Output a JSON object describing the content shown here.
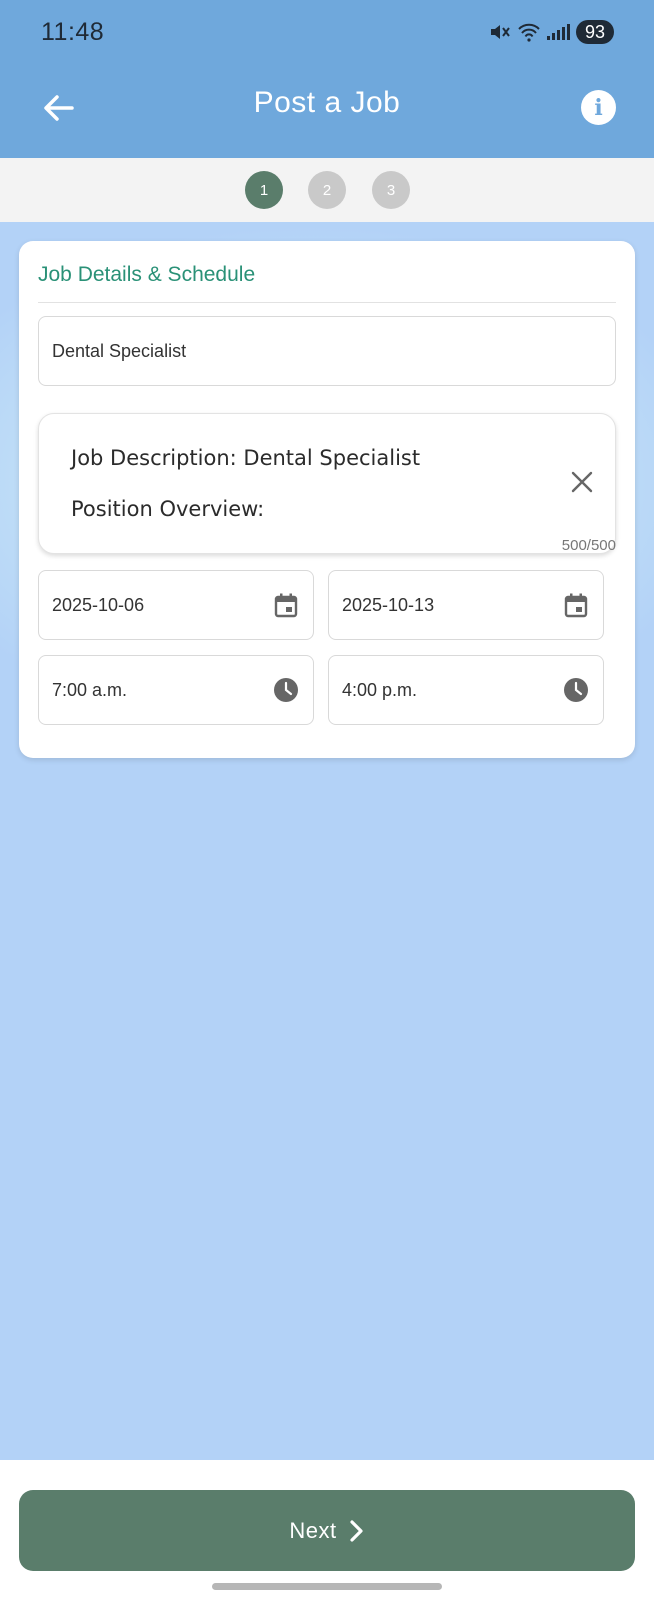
{
  "status_bar": {
    "time": "11:48",
    "battery": "93"
  },
  "header": {
    "title": "Post a Job"
  },
  "stepper": {
    "steps": [
      "1",
      "2",
      "3"
    ],
    "active": 1
  },
  "card": {
    "title": "Job Details & Schedule",
    "job_title_value": "Dental Specialist",
    "description": {
      "line1": "Job Description: Dental Specialist",
      "line2": "Position Overview:",
      "char_count": "500/500"
    },
    "start_date": "2025-10-06",
    "end_date": "2025-10-13",
    "start_time": "7:00 a.m.",
    "end_time": "4:00 p.m."
  },
  "footer": {
    "next_label": "Next"
  },
  "colors": {
    "header": "#6fa8dc",
    "accent": "#5a7d6b",
    "title_green": "#2a9177"
  }
}
